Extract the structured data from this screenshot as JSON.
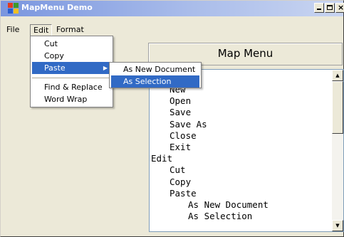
{
  "window": {
    "title": "MapMenu Demo",
    "controls": {
      "minimize": "minimize",
      "maximize": "maximize",
      "close": "close"
    }
  },
  "menubar": {
    "items": [
      "File",
      "Edit",
      "Format"
    ],
    "active": "Edit"
  },
  "edit_menu": {
    "items": [
      {
        "label": "Cut"
      },
      {
        "label": "Copy"
      },
      {
        "label": "Paste",
        "has_submenu": true,
        "highlighted": true
      },
      {
        "label": "Find & Replace"
      },
      {
        "label": "Word Wrap"
      }
    ]
  },
  "paste_submenu": {
    "items": [
      {
        "label": "As New Document"
      },
      {
        "label": "As Selection",
        "highlighted": true
      }
    ]
  },
  "panel": {
    "title": "Map Menu"
  },
  "tree": {
    "lines": [
      {
        "text": "New",
        "level": 1
      },
      {
        "text": "Open",
        "level": 1
      },
      {
        "text": "Save",
        "level": 1
      },
      {
        "text": "Save As",
        "level": 1
      },
      {
        "text": "Close",
        "level": 1
      },
      {
        "text": "Exit",
        "level": 1
      },
      {
        "text": "Edit",
        "level": 0
      },
      {
        "text": "Cut",
        "level": 1
      },
      {
        "text": "Copy",
        "level": 1
      },
      {
        "text": "Paste",
        "level": 1
      },
      {
        "text": "As New Document",
        "level": 2
      },
      {
        "text": "As Selection",
        "level": 2
      }
    ]
  },
  "colors": {
    "highlight": "#316ac5",
    "titlebar_start": "#7a96df",
    "titlebar_end": "#c9d5f1",
    "face": "#ece9d8"
  },
  "icons": {
    "app": "app-icon",
    "submenu_arrow": "chevron-right-icon",
    "scroll_up": "arrow-up-icon",
    "scroll_down": "arrow-down-icon"
  }
}
